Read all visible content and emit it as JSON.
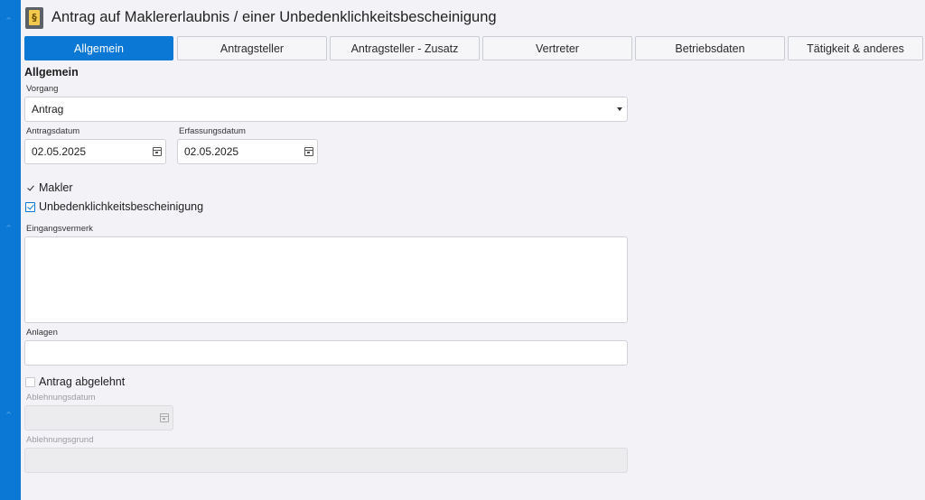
{
  "window": {
    "title": "Antrag auf Maklererlaubnis / einer Unbedenklichkeitsbescheinigung",
    "icon": "document-paragraph-icon"
  },
  "tabs": [
    {
      "label": "Allgemein",
      "active": true
    },
    {
      "label": "Antragsteller",
      "active": false
    },
    {
      "label": "Antragsteller - Zusatz",
      "active": false
    },
    {
      "label": "Vertreter",
      "active": false
    },
    {
      "label": "Betriebsdaten",
      "active": false
    },
    {
      "label": "Tätigkeit & anderes",
      "active": false
    }
  ],
  "form": {
    "section_title": "Allgemein",
    "vorgang": {
      "label": "Vorgang",
      "value": "Antrag"
    },
    "antragsdatum": {
      "label": "Antragsdatum",
      "value": "02.05.2025"
    },
    "erfassungsdatum": {
      "label": "Erfassungsdatum",
      "value": "02.05.2025"
    },
    "makler": {
      "label": "Makler",
      "checked": true
    },
    "unbedenklichkeit": {
      "label": "Unbedenklichkeitsbescheinigung",
      "checked": true
    },
    "eingangsvermerk": {
      "label": "Eingangsvermerk",
      "value": ""
    },
    "anlagen": {
      "label": "Anlagen",
      "value": ""
    },
    "abgelehnt": {
      "label": "Antrag abgelehnt",
      "checked": false
    },
    "ablehnungsdatum": {
      "label": "Ablehnungsdatum",
      "value": ""
    },
    "ablehnungsgrund": {
      "label": "Ablehnungsgrund",
      "value": ""
    }
  },
  "colors": {
    "accent": "#0a78d4",
    "background": "#f3f3f7"
  }
}
